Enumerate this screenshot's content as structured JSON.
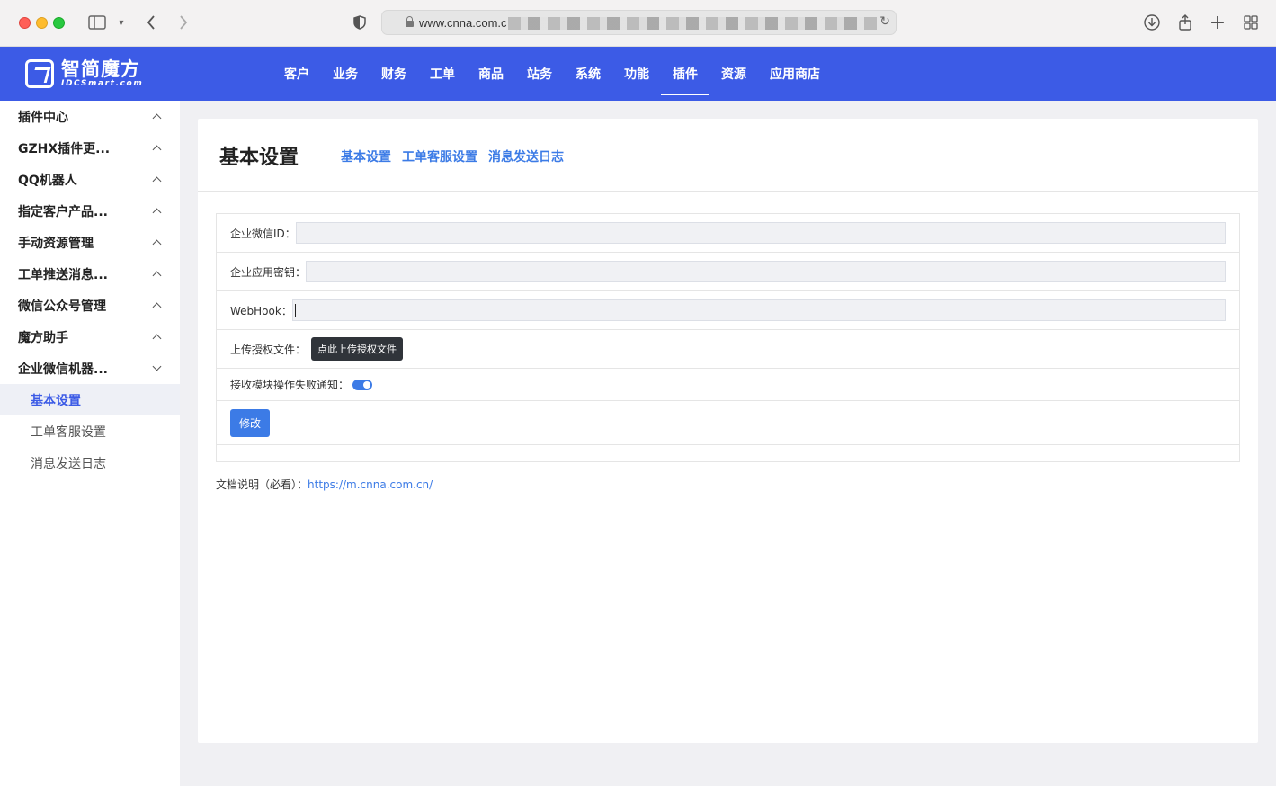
{
  "browser": {
    "url": "www.cnna.com.c"
  },
  "brand": {
    "name_cn": "智简魔方",
    "name_en": "IDCSmart.com",
    "nav_color": "#3c5be6"
  },
  "nav": {
    "items": [
      {
        "label": "客户",
        "active": false
      },
      {
        "label": "业务",
        "active": false
      },
      {
        "label": "财务",
        "active": false
      },
      {
        "label": "工单",
        "active": false
      },
      {
        "label": "商品",
        "active": false
      },
      {
        "label": "站务",
        "active": false
      },
      {
        "label": "系统",
        "active": false
      },
      {
        "label": "功能",
        "active": false
      },
      {
        "label": "插件",
        "active": true
      },
      {
        "label": "资源",
        "active": false
      },
      {
        "label": "应用商店",
        "active": false
      }
    ]
  },
  "sidebar": {
    "items": [
      {
        "label": "插件中心",
        "expanded": false
      },
      {
        "label": "GZHX插件更...",
        "expanded": false
      },
      {
        "label": "QQ机器人",
        "expanded": false
      },
      {
        "label": "指定客户产品...",
        "expanded": false
      },
      {
        "label": "手动资源管理",
        "expanded": false
      },
      {
        "label": "工单推送消息...",
        "expanded": false
      },
      {
        "label": "微信公众号管理",
        "expanded": false
      },
      {
        "label": "魔方助手",
        "expanded": false
      },
      {
        "label": "企业微信机器...",
        "expanded": true
      }
    ],
    "subitems": [
      {
        "label": "基本设置",
        "active": true
      },
      {
        "label": "工单客服设置",
        "active": false
      },
      {
        "label": "消息发送日志",
        "active": false
      }
    ]
  },
  "page": {
    "title": "基本设置",
    "tabs": [
      "基本设置",
      "工单客服设置",
      "消息发送日志"
    ]
  },
  "form": {
    "corp_id_label": "企业微信ID：",
    "corp_id_value": "",
    "app_secret_label": "企业应用密钥：",
    "app_secret_value": "",
    "webhook_label": "WebHook：",
    "webhook_value": "",
    "upload_label": "上传授权文件：",
    "upload_button": "点此上传授权文件",
    "notify_label": "接收模块操作失败通知：",
    "notify_enabled": true,
    "submit_label": "修改"
  },
  "doc": {
    "label": "文档说明（必看）：",
    "link": "https://m.cnna.com.cn/"
  }
}
